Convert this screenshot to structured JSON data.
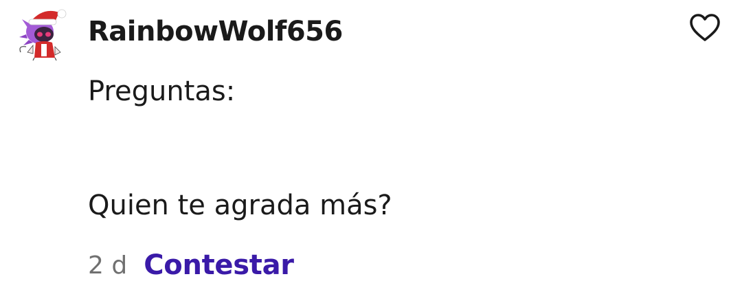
{
  "comment": {
    "author": "RainbowWolf656",
    "avatar_icon": "santa-wolf-avatar",
    "like_icon": "heart-outline-icon",
    "body_lines": [
      "Preguntas:",
      "Quien te agrada más?"
    ],
    "time_ago": "2 d",
    "reply_label": "Contestar"
  },
  "colors": {
    "text": "#1a1a1a",
    "muted": "#707070",
    "accent": "#3a1aa8",
    "avatar_hair": "#a35bd6",
    "santa_red": "#d32a2a"
  }
}
